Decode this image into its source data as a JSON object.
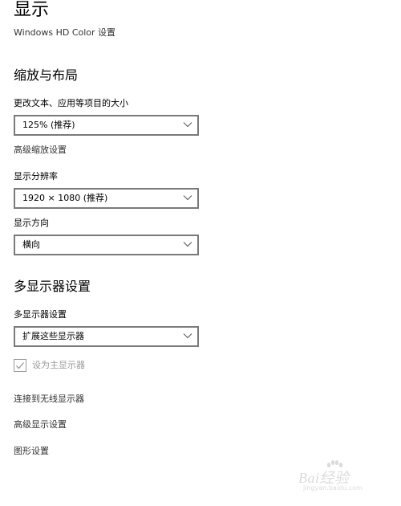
{
  "page": {
    "title": "显示",
    "hdr_link": "Windows HD Color 设置"
  },
  "scale_section": {
    "heading": "缩放与布局",
    "text_size_label": "更改文本、应用等项目的大小",
    "text_size_value": "125% (推荐)",
    "advanced_scaling_link": "高级缩放设置",
    "resolution_label": "显示分辨率",
    "resolution_value": "1920 × 1080 (推荐)",
    "orientation_label": "显示方向",
    "orientation_value": "横向"
  },
  "multi_section": {
    "heading": "多显示器设置",
    "multi_label": "多显示器设置",
    "multi_value": "扩展这些显示器",
    "primary_checkbox_label": "设为主显示器",
    "primary_checked": true,
    "wireless_link": "连接到无线显示器",
    "advanced_display_link": "高级显示设置",
    "graphics_link": "图形设置"
  },
  "watermark": {
    "main": "Bai经验",
    "sub": "jingyan.baidu.com"
  },
  "icons": {
    "dropdown_chevron": "chevron-down-icon",
    "checkbox_check": "check-icon",
    "watermark_paw": "paw-icon"
  },
  "colors": {
    "dropdown_border": "#7a7a7a",
    "disabled_text": "#9a9a9a",
    "link_text": "#333333"
  }
}
